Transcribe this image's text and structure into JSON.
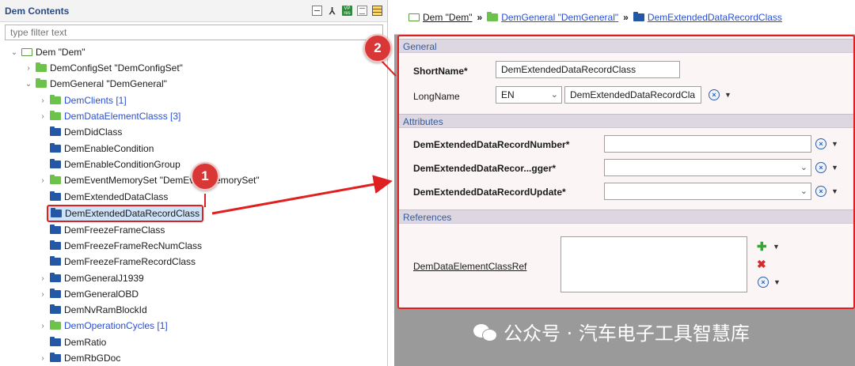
{
  "left_panel": {
    "title": "Dem Contents",
    "filter_placeholder": "type filter text",
    "tree": [
      {
        "label": "Dem \"Dem\"",
        "expanded": true,
        "icon": "hollow"
      },
      {
        "label": "DemConfigSet \"DemConfigSet\"",
        "expanded": false,
        "icon": "green"
      },
      {
        "label": "DemGeneral \"DemGeneral\"",
        "expanded": true,
        "icon": "green"
      },
      {
        "label": "DemClients [1]",
        "expanded": false,
        "icon": "green",
        "link": true
      },
      {
        "label": "DemDataElementClasss [3]",
        "expanded": false,
        "icon": "green",
        "link": true
      },
      {
        "label": "DemDidClass",
        "icon": "blue"
      },
      {
        "label": "DemEnableCondition",
        "icon": "blue"
      },
      {
        "label": "DemEnableConditionGroup",
        "icon": "blue"
      },
      {
        "label": "DemEventMemorySet \"DemEventMemorySet\"",
        "expanded": false,
        "icon": "green"
      },
      {
        "label": "DemExtendedDataClass",
        "icon": "blue"
      },
      {
        "label": "DemExtendedDataRecordClass",
        "icon": "blue",
        "selected": true
      },
      {
        "label": "DemFreezeFrameClass",
        "icon": "blue"
      },
      {
        "label": "DemFreezeFrameRecNumClass",
        "icon": "blue"
      },
      {
        "label": "DemFreezeFrameRecordClass",
        "icon": "blue"
      },
      {
        "label": "DemGeneralJ1939",
        "expanded": false,
        "icon": "blue"
      },
      {
        "label": "DemGeneralOBD",
        "expanded": false,
        "icon": "blue"
      },
      {
        "label": "DemNvRamBlockId",
        "icon": "blue"
      },
      {
        "label": "DemOperationCycles [1]",
        "expanded": false,
        "icon": "green",
        "link": true
      },
      {
        "label": "DemRatio",
        "icon": "blue"
      },
      {
        "label": "DemRbGDoc",
        "expanded": false,
        "icon": "blue"
      }
    ]
  },
  "breadcrumb": {
    "items": [
      "Dem \"Dem\"",
      "DemGeneral \"DemGeneral\"",
      "DemExtendedDataRecordClass"
    ]
  },
  "form": {
    "general": {
      "header": "General",
      "short_name_label": "ShortName*",
      "short_name_value": "DemExtendedDataRecordClass",
      "long_name_label": "LongName",
      "language": "EN",
      "long_name_value": "DemExtendedDataRecordCla"
    },
    "attributes": {
      "header": "Attributes",
      "fields": [
        {
          "label": "DemExtendedDataRecordNumber*",
          "value": "",
          "type": "text"
        },
        {
          "label": "DemExtendedDataRecor...gger*",
          "value": "",
          "type": "select"
        },
        {
          "label": "DemExtendedDataRecordUpdate*",
          "value": "",
          "type": "select"
        }
      ]
    },
    "references": {
      "header": "References",
      "ref_label": "DemDataElementClassRef"
    }
  },
  "annotations": {
    "badge1": "1",
    "badge2": "2"
  },
  "watermark": "公众号 · 汽车电子工具智慧库",
  "colors": {
    "highlight": "#e02020",
    "link": "#2a4fd6",
    "section_header": "#365a9a"
  }
}
